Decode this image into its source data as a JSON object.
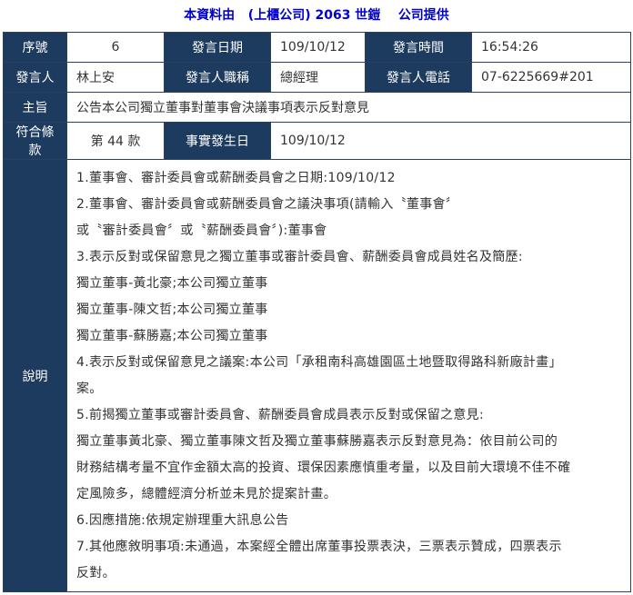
{
  "header": {
    "prefix": "本資料由",
    "company": "(上櫃公司) 2063 世鎧",
    "suffix": "公司提供"
  },
  "labels": {
    "seq": "序號",
    "date": "發言日期",
    "time": "發言時間",
    "speaker": "發言人",
    "title": "發言人職稱",
    "phone": "發言人電話",
    "subject": "主旨",
    "clause": "符合條款",
    "event_date": "事實發生日",
    "description": "說明"
  },
  "values": {
    "seq": "6",
    "date": "109/10/12",
    "time": "16:54:26",
    "speaker": "林上安",
    "title": "總經理",
    "phone": "07-6225669#201",
    "subject": "公告本公司獨立董事對董事會決議事項表示反對意見",
    "clause": "第 44 款",
    "event_date": "109/10/12"
  },
  "description_lines": [
    "1.董事會、審計委員會或薪酬委員會之日期:109/10/12",
    "2.董事會、審計委員會或薪酬委員會之議決事項(請輸入〝董事會〞",
    "或〝審計委員會〞或〝薪酬委員會〞):董事會",
    "3.表示反對或保留意見之獨立董事或審計委員會、薪酬委員會成員姓名及簡歷:",
    "獨立董事-黃北豪;本公司獨立董事",
    "獨立董事-陳文哲;本公司獨立董事",
    "獨立董事-蘇勝嘉;本公司獨立董事",
    "4.表示反對或保留意見之議案:本公司「承租南科高雄園區土地暨取得路科新廠計畫」",
    "案。",
    "5.前揭獨立董事或審計委員會、薪酬委員會成員表示反對或保留之意見:",
    "獨立董事黃北豪、獨立董事陳文哲及獨立董事蘇勝嘉表示反對意見為：依目前公司的",
    "財務結構考量不宜作金額太高的投資、環保因素應慎重考量，以及目前大環境不佳不確",
    "定風險多，總體經濟分析並未見於提案計畫。",
    "6.因應措施:依規定辦理重大訊息公告",
    "7.其他應敘明事項:未通過，本案經全體出席董事投票表決，三票表示贊成，四票表示",
    "反對。"
  ]
}
